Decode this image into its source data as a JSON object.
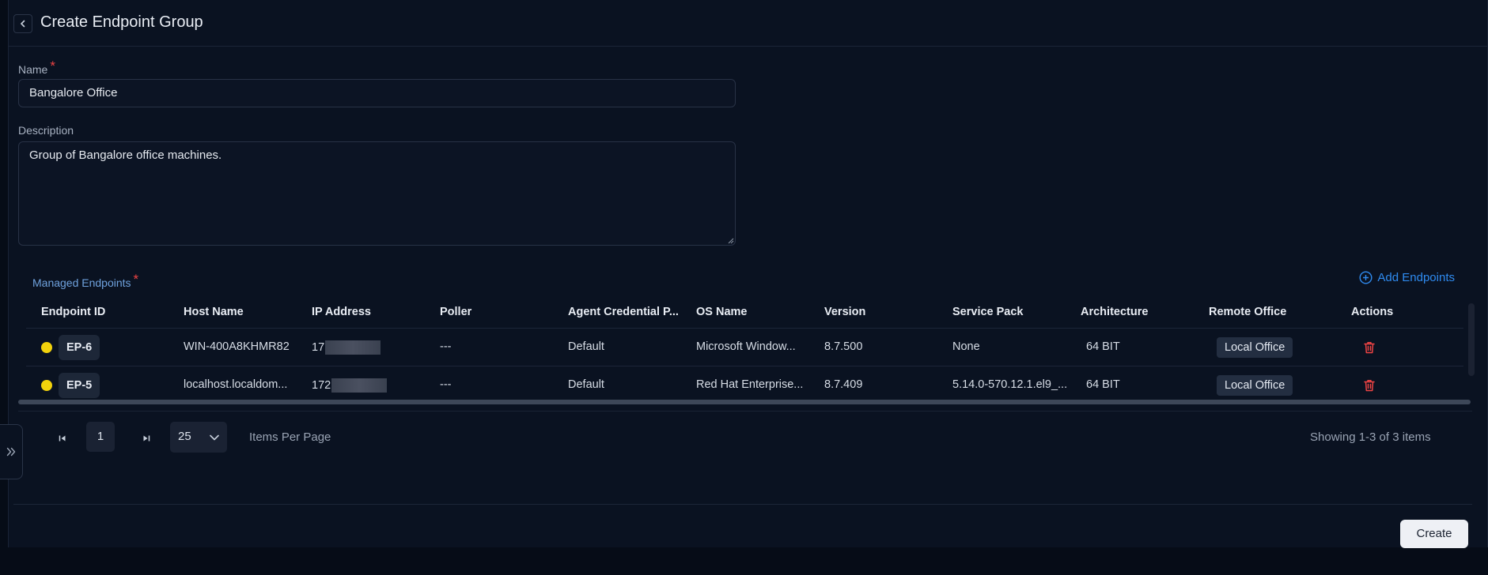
{
  "header": {
    "title": "Create Endpoint Group"
  },
  "form": {
    "name_label": "Name",
    "name_required": "*",
    "name_value": "Bangalore Office",
    "description_label": "Description",
    "description_value": "Group of Bangalore office machines."
  },
  "endpoints": {
    "section_label": "Managed Endpoints",
    "required": "*",
    "add_label": "Add Endpoints",
    "columns": [
      "Endpoint ID",
      "Host Name",
      "IP Address",
      "Poller",
      "Agent Credential P...",
      "OS Name",
      "Version",
      "Service Pack",
      "Architecture",
      "Remote Office",
      "Actions"
    ],
    "rows": [
      {
        "id": "EP-6",
        "status_color": "#f2d20c",
        "host": "WIN-400A8KHMR82",
        "ip_prefix": "17",
        "poller": "---",
        "credential": "Default",
        "os": "Microsoft Window...",
        "version": "8.7.500",
        "service_pack": "None",
        "arch": "64 BIT",
        "remote_office": "Local Office"
      },
      {
        "id": "EP-5",
        "status_color": "#f2d20c",
        "host": "localhost.localdom...",
        "ip_prefix": "172",
        "poller": "---",
        "credential": "Default",
        "os": "Red Hat Enterprise...",
        "version": "8.7.409",
        "service_pack": "5.14.0-570.12.1.el9_...",
        "arch": "64 BIT",
        "remote_office": "Local Office"
      }
    ]
  },
  "pagination": {
    "current_page": "1",
    "per_page": "25",
    "per_page_label": "Items Per Page",
    "summary": "Showing 1-3 of 3 items"
  },
  "footer": {
    "create_label": "Create"
  },
  "colors": {
    "accent": "#2f8bf0",
    "danger": "#ef4444",
    "status_warning": "#f2d20c",
    "background": "#0a1221"
  }
}
